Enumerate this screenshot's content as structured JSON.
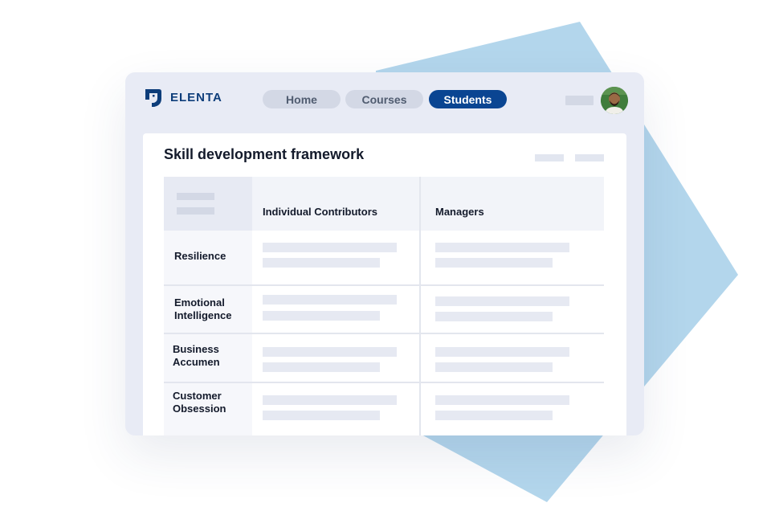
{
  "brand": {
    "name": "ELENTA",
    "color": "#0d3d7a"
  },
  "nav": {
    "items": [
      {
        "label": "Home",
        "active": false
      },
      {
        "label": "Courses",
        "active": false
      },
      {
        "label": "Students",
        "active": true
      }
    ]
  },
  "header": {
    "avatar_icon": "user-avatar"
  },
  "card": {
    "title": "Skill development framework",
    "table": {
      "columns": [
        "Individual Contributors",
        "Managers"
      ],
      "rows": [
        {
          "label": "Resilience"
        },
        {
          "label": "Emotional Intelligence"
        },
        {
          "label": "Business Accumen"
        },
        {
          "label": "Customer Obsession"
        }
      ]
    }
  },
  "colors": {
    "accent": "#0a4592",
    "window_bg": "#e8ebf5",
    "background_shape": "#b3d6ec",
    "placeholder": "#e6e9f2"
  }
}
